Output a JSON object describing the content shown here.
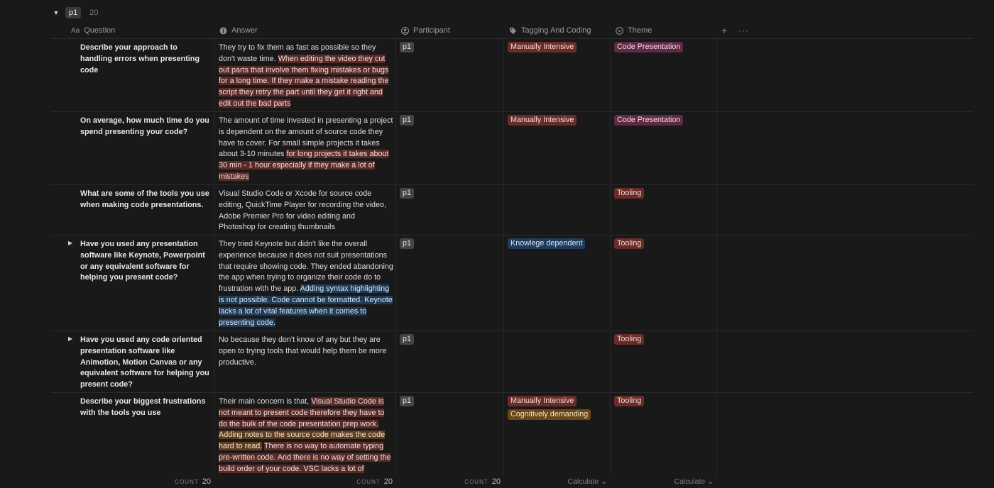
{
  "group": {
    "caret": "▼",
    "label": "p1",
    "count": "20"
  },
  "headers": {
    "question": {
      "prefix": "Aa",
      "label": "Question"
    },
    "answer": {
      "label": "Answer",
      "icon": "info-icon"
    },
    "participant": {
      "label": "Participant",
      "icon": "person-icon"
    },
    "tagging": {
      "label": "Tagging And Coding",
      "icon": "tag-icon"
    },
    "theme": {
      "label": "Theme",
      "icon": "circle-chevron-icon"
    },
    "add": "+",
    "more": "···"
  },
  "rows": [
    {
      "toggle": "",
      "question": "Describe your approach to handling errors when presenting code",
      "answer": [
        {
          "text": "They try to fix them as fast as possible so they don't waste time. ",
          "hl": ""
        },
        {
          "text": "When editing the video they cut out parts that involve them fixing mistakes or bugs for a long time. If they make a mistake reading the script they retry the part until they get it right and edit out the bad parts",
          "hl": "red"
        }
      ],
      "participant": "p1",
      "tags": [
        {
          "label": "Manually Intensive",
          "color": "red"
        }
      ],
      "themes": [
        {
          "label": "Code Presentation",
          "color": "pink"
        }
      ]
    },
    {
      "toggle": "",
      "question": "On average, how much time do you spend presenting your code?",
      "answer": [
        {
          "text": "The amount of time invested in presenting a project is dependent on the amount of source code they have to cover. For small simple projects it takes about 3-10 minutes ",
          "hl": ""
        },
        {
          "text": "for long projects it takes about 30 min - 1 hour especially if they make a lot of mistakes",
          "hl": "red"
        }
      ],
      "participant": "p1",
      "tags": [
        {
          "label": "Manually Intensive",
          "color": "red"
        }
      ],
      "themes": [
        {
          "label": "Code Presentation",
          "color": "pink"
        }
      ]
    },
    {
      "toggle": "",
      "question": "What are some of the tools you use when making code presentations.",
      "answer": [
        {
          "text": "Visual Studio Code or Xcode for source code editing, QuickTime Player for recording the video, Adobe Premier Pro for video editing and Photoshop for creating thumbnails",
          "hl": ""
        }
      ],
      "participant": "p1",
      "tags": [],
      "themes": [
        {
          "label": "Tooling",
          "color": "red"
        }
      ]
    },
    {
      "toggle": "▶",
      "question": "Have you used any presentation software like Keynote, Powerpoint or any equivalent software for helping you present code?",
      "answer": [
        {
          "text": "They tried Keynote but didn't like the overall experience because it does not suit presentations that require showing code. They ended abandoning the app when trying to organize their code do to frustration with the app. ",
          "hl": ""
        },
        {
          "text": "Adding syntax highlighting is not possible. Code cannot be formatted. Keynote lacks a lot of vital features when it comes to presenting code.",
          "hl": "blue"
        }
      ],
      "participant": "p1",
      "tags": [
        {
          "label": "Knowlege dependent",
          "color": "blue"
        }
      ],
      "themes": [
        {
          "label": "Tooling",
          "color": "red"
        }
      ]
    },
    {
      "toggle": "▶",
      "question": "Have you used any code oriented presentation software like Animotion, Motion Canvas or any equivalent software for helping you present code?",
      "answer": [
        {
          "text": "No because they don't know of any but they are open to trying tools that would help them be more productive.",
          "hl": ""
        }
      ],
      "participant": "p1",
      "tags": [],
      "themes": [
        {
          "label": "Tooling",
          "color": "red"
        }
      ]
    },
    {
      "toggle": "",
      "question": "Describe your biggest frustrations with the tools you use",
      "answer": [
        {
          "text": "Their main concern is that, ",
          "hl": ""
        },
        {
          "text": "Visual Studio Code is not meant to present code therefore they have to do the bulk of the code presentation prep work.",
          "hl": "red"
        },
        {
          "text": " ",
          "hl": ""
        },
        {
          "text": "Adding notes to the source code makes the code hard to read.",
          "hl": "orange"
        },
        {
          "text": " ",
          "hl": ""
        },
        {
          "text": "There is no way to automate typing pre-written code. And there is no way of setting the build order of your code. VSC lacks a lot of",
          "hl": "red"
        }
      ],
      "participant": "p1",
      "tags": [
        {
          "label": "Manually Intensive",
          "color": "red"
        },
        {
          "label": "Cognitively demanding",
          "color": "orange"
        }
      ],
      "themes": [
        {
          "label": "Tooling",
          "color": "red"
        }
      ]
    }
  ],
  "footer": {
    "question": {
      "label": "COUNT",
      "value": "20"
    },
    "answer": {
      "label": "COUNT",
      "value": "20"
    },
    "participant": {
      "label": "COUNT",
      "value": "20"
    },
    "tagging": "Calculate ⌄",
    "theme": "Calculate ⌄"
  },
  "colors": {
    "background": "#191919",
    "highlight_red": "#5a2a26",
    "highlight_orange": "#5c3d1d",
    "highlight_blue": "#1f3a55",
    "chip_red": "#6a2c28",
    "chip_pink": "#5e2a44",
    "chip_blue": "#203b5c",
    "chip_orange": "#6a4718",
    "chip_gray": "#454545"
  }
}
